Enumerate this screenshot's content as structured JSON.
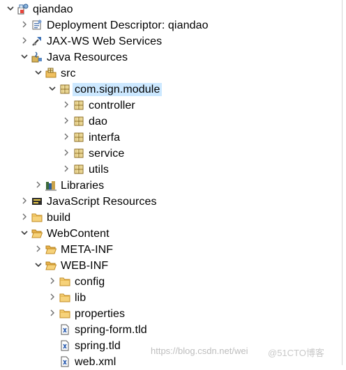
{
  "tree": {
    "nodes": [
      {
        "label": "qiandao",
        "depth": 0,
        "state": "expanded",
        "icon": "project-icon"
      },
      {
        "label": "Deployment Descriptor: qiandao",
        "depth": 1,
        "state": "collapsed",
        "icon": "deployment-descriptor-icon"
      },
      {
        "label": "JAX-WS Web Services",
        "depth": 1,
        "state": "collapsed",
        "icon": "web-services-icon"
      },
      {
        "label": "Java Resources",
        "depth": 1,
        "state": "expanded",
        "icon": "java-resources-icon"
      },
      {
        "label": "src",
        "depth": 2,
        "state": "expanded",
        "icon": "source-folder-icon"
      },
      {
        "label": "com.sign.module",
        "depth": 3,
        "state": "expanded",
        "icon": "package-icon",
        "selected": true
      },
      {
        "label": "controller",
        "depth": 4,
        "state": "collapsed",
        "icon": "package-icon"
      },
      {
        "label": "dao",
        "depth": 4,
        "state": "collapsed",
        "icon": "package-icon"
      },
      {
        "label": "interfa",
        "depth": 4,
        "state": "collapsed",
        "icon": "package-icon"
      },
      {
        "label": "service",
        "depth": 4,
        "state": "collapsed",
        "icon": "package-icon"
      },
      {
        "label": "utils",
        "depth": 4,
        "state": "collapsed",
        "icon": "package-icon"
      },
      {
        "label": "Libraries",
        "depth": 2,
        "state": "collapsed",
        "icon": "libraries-icon"
      },
      {
        "label": "JavaScript Resources",
        "depth": 1,
        "state": "collapsed",
        "icon": "javascript-resources-icon"
      },
      {
        "label": "build",
        "depth": 1,
        "state": "collapsed",
        "icon": "folder-icon"
      },
      {
        "label": "WebContent",
        "depth": 1,
        "state": "expanded",
        "icon": "open-folder-icon"
      },
      {
        "label": "META-INF",
        "depth": 2,
        "state": "collapsed",
        "icon": "open-folder-icon"
      },
      {
        "label": "WEB-INF",
        "depth": 2,
        "state": "expanded",
        "icon": "open-folder-icon"
      },
      {
        "label": "config",
        "depth": 3,
        "state": "collapsed",
        "icon": "folder-icon"
      },
      {
        "label": "lib",
        "depth": 3,
        "state": "collapsed",
        "icon": "folder-icon"
      },
      {
        "label": "properties",
        "depth": 3,
        "state": "collapsed",
        "icon": "folder-icon"
      },
      {
        "label": "spring-form.tld",
        "depth": 3,
        "state": "leaf",
        "icon": "xml-file-icon"
      },
      {
        "label": "spring.tld",
        "depth": 3,
        "state": "leaf",
        "icon": "xml-file-icon"
      },
      {
        "label": "web.xml",
        "depth": 3,
        "state": "leaf",
        "icon": "xml-file-icon"
      }
    ]
  },
  "watermark": {
    "url_text": "https://blog.csdn.net/wei",
    "brand_text": "@51CTO博客"
  },
  "colors": {
    "selection": "#cce8ff",
    "twisty": "#6e6e6e",
    "folder": "#e8b04b",
    "package_fill": "#f2e4a9",
    "package_stroke": "#8a6a1f"
  }
}
